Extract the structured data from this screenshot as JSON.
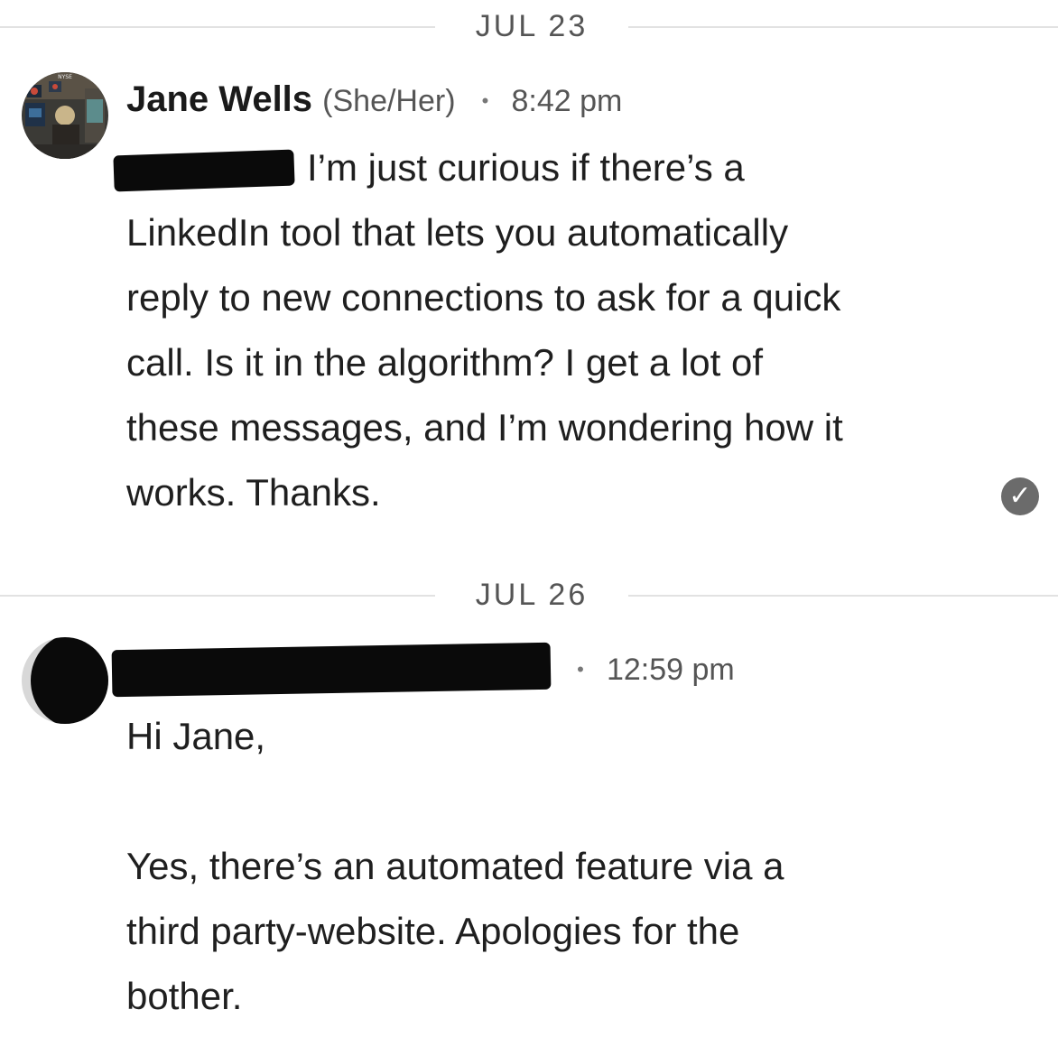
{
  "thread": {
    "day1": {
      "date_label": "JUL 23",
      "message": {
        "sender_name": "Jane Wells",
        "sender_pronouns": "(She/Her)",
        "separator": "•",
        "time": "8:42 pm",
        "body_lines": [
          "I’m just curious if there’s a",
          "LinkedIn tool that lets you automatically",
          "reply to new connections to ask for a quick",
          "call. Is it in the algorithm? I get a lot of",
          "these messages, and I’m wondering how it",
          "works. Thanks."
        ],
        "status_icon": "check-circle-icon"
      }
    },
    "day2": {
      "date_label": "JUL 26",
      "message": {
        "separator": "•",
        "time": "12:59 pm",
        "greeting": "Hi Jane,",
        "body_lines": [
          "Yes, there’s an automated feature via a",
          "third party-website. Apologies for the",
          "bother."
        ]
      }
    }
  },
  "colors": {
    "text": "#1f1f1f",
    "muted": "#555555",
    "divider": "#e2e2e2",
    "redaction": "#0a0a0a",
    "receipt": "#6b6b6b"
  }
}
